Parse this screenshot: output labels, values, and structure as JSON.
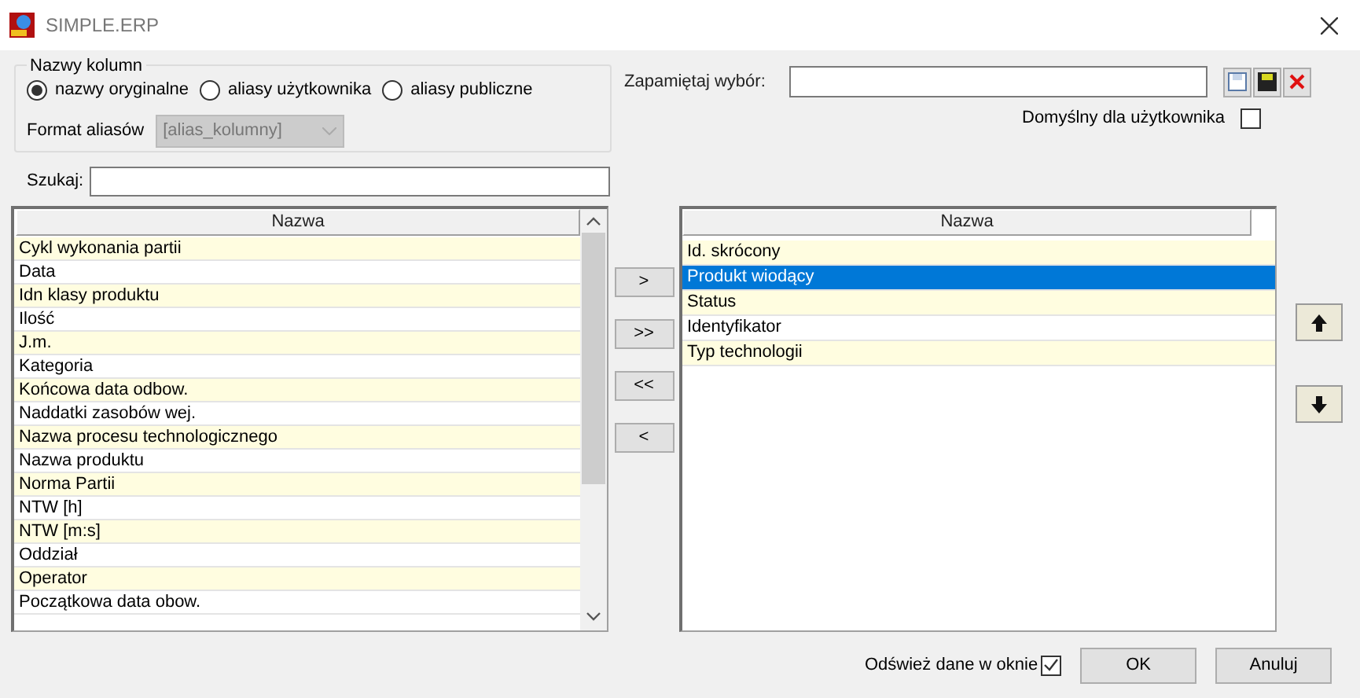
{
  "window": {
    "title": "SIMPLE.ERP"
  },
  "column_names": {
    "title": "Nazwy kolumn",
    "options": [
      {
        "label": "nazwy oryginalne",
        "selected": true
      },
      {
        "label": "aliasy użytkownika",
        "selected": false
      },
      {
        "label": "aliasy publiczne",
        "selected": false
      }
    ],
    "alias_format": {
      "label": "Format aliasów",
      "value": "[alias_kolumny]",
      "disabled": true
    }
  },
  "search": {
    "label": "Szukaj:"
  },
  "remember": {
    "label": "Zapamiętaj wybór:"
  },
  "default_for_user": {
    "label": "Domyślny dla użytkownika",
    "checked": false
  },
  "available_columns": {
    "header": "Nazwa",
    "rows": [
      {
        "label": "Cykl wykonania partii"
      },
      {
        "label": "Data"
      },
      {
        "label": "Idn klasy produktu"
      },
      {
        "label": "Ilość"
      },
      {
        "label": "J.m."
      },
      {
        "label": "Kategoria"
      },
      {
        "label": "Końcowa data odbow."
      },
      {
        "label": "Naddatki zasobów wej."
      },
      {
        "label": "Nazwa procesu technologicznego"
      },
      {
        "label": "Nazwa produktu"
      },
      {
        "label": "Norma Partii"
      },
      {
        "label": "NTW [h]"
      },
      {
        "label": "NTW [m:s]"
      },
      {
        "label": "Oddział"
      },
      {
        "label": "Operator"
      },
      {
        "label": "Początkowa data obow."
      }
    ]
  },
  "transfer_buttons": [
    ">",
    ">>",
    "<<",
    "<"
  ],
  "selected_columns": {
    "header": "Nazwa",
    "rows": [
      {
        "label": "Id. skrócony",
        "selected": false
      },
      {
        "label": "Produkt wiodący",
        "selected": true
      },
      {
        "label": "Status",
        "selected": false
      },
      {
        "label": "Identyfikator",
        "selected": false
      },
      {
        "label": "Typ technologii",
        "selected": false
      }
    ]
  },
  "refresh": {
    "label": "Odśwież dane w oknie",
    "checked": true
  },
  "buttons": [
    "OK",
    "Anuluj"
  ]
}
